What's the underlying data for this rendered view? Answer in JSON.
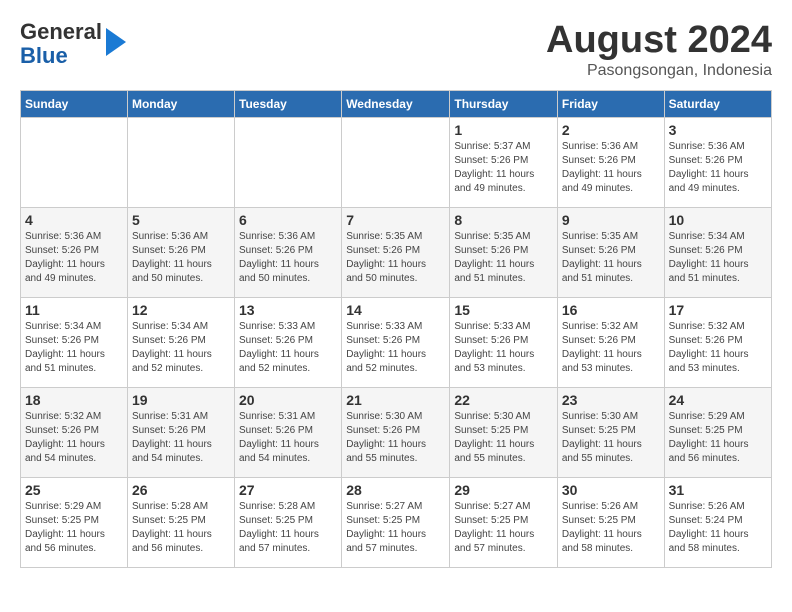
{
  "logo": {
    "line1": "General",
    "line2": "Blue"
  },
  "header": {
    "month": "August 2024",
    "location": "Pasongsongan, Indonesia"
  },
  "weekdays": [
    "Sunday",
    "Monday",
    "Tuesday",
    "Wednesday",
    "Thursday",
    "Friday",
    "Saturday"
  ],
  "weeks": [
    [
      {
        "day": "",
        "info": ""
      },
      {
        "day": "",
        "info": ""
      },
      {
        "day": "",
        "info": ""
      },
      {
        "day": "",
        "info": ""
      },
      {
        "day": "1",
        "info": "Sunrise: 5:37 AM\nSunset: 5:26 PM\nDaylight: 11 hours and 49 minutes."
      },
      {
        "day": "2",
        "info": "Sunrise: 5:36 AM\nSunset: 5:26 PM\nDaylight: 11 hours and 49 minutes."
      },
      {
        "day": "3",
        "info": "Sunrise: 5:36 AM\nSunset: 5:26 PM\nDaylight: 11 hours and 49 minutes."
      }
    ],
    [
      {
        "day": "4",
        "info": "Sunrise: 5:36 AM\nSunset: 5:26 PM\nDaylight: 11 hours and 49 minutes."
      },
      {
        "day": "5",
        "info": "Sunrise: 5:36 AM\nSunset: 5:26 PM\nDaylight: 11 hours and 50 minutes."
      },
      {
        "day": "6",
        "info": "Sunrise: 5:36 AM\nSunset: 5:26 PM\nDaylight: 11 hours and 50 minutes."
      },
      {
        "day": "7",
        "info": "Sunrise: 5:35 AM\nSunset: 5:26 PM\nDaylight: 11 hours and 50 minutes."
      },
      {
        "day": "8",
        "info": "Sunrise: 5:35 AM\nSunset: 5:26 PM\nDaylight: 11 hours and 51 minutes."
      },
      {
        "day": "9",
        "info": "Sunrise: 5:35 AM\nSunset: 5:26 PM\nDaylight: 11 hours and 51 minutes."
      },
      {
        "day": "10",
        "info": "Sunrise: 5:34 AM\nSunset: 5:26 PM\nDaylight: 11 hours and 51 minutes."
      }
    ],
    [
      {
        "day": "11",
        "info": "Sunrise: 5:34 AM\nSunset: 5:26 PM\nDaylight: 11 hours and 51 minutes."
      },
      {
        "day": "12",
        "info": "Sunrise: 5:34 AM\nSunset: 5:26 PM\nDaylight: 11 hours and 52 minutes."
      },
      {
        "day": "13",
        "info": "Sunrise: 5:33 AM\nSunset: 5:26 PM\nDaylight: 11 hours and 52 minutes."
      },
      {
        "day": "14",
        "info": "Sunrise: 5:33 AM\nSunset: 5:26 PM\nDaylight: 11 hours and 52 minutes."
      },
      {
        "day": "15",
        "info": "Sunrise: 5:33 AM\nSunset: 5:26 PM\nDaylight: 11 hours and 53 minutes."
      },
      {
        "day": "16",
        "info": "Sunrise: 5:32 AM\nSunset: 5:26 PM\nDaylight: 11 hours and 53 minutes."
      },
      {
        "day": "17",
        "info": "Sunrise: 5:32 AM\nSunset: 5:26 PM\nDaylight: 11 hours and 53 minutes."
      }
    ],
    [
      {
        "day": "18",
        "info": "Sunrise: 5:32 AM\nSunset: 5:26 PM\nDaylight: 11 hours and 54 minutes."
      },
      {
        "day": "19",
        "info": "Sunrise: 5:31 AM\nSunset: 5:26 PM\nDaylight: 11 hours and 54 minutes."
      },
      {
        "day": "20",
        "info": "Sunrise: 5:31 AM\nSunset: 5:26 PM\nDaylight: 11 hours and 54 minutes."
      },
      {
        "day": "21",
        "info": "Sunrise: 5:30 AM\nSunset: 5:26 PM\nDaylight: 11 hours and 55 minutes."
      },
      {
        "day": "22",
        "info": "Sunrise: 5:30 AM\nSunset: 5:25 PM\nDaylight: 11 hours and 55 minutes."
      },
      {
        "day": "23",
        "info": "Sunrise: 5:30 AM\nSunset: 5:25 PM\nDaylight: 11 hours and 55 minutes."
      },
      {
        "day": "24",
        "info": "Sunrise: 5:29 AM\nSunset: 5:25 PM\nDaylight: 11 hours and 56 minutes."
      }
    ],
    [
      {
        "day": "25",
        "info": "Sunrise: 5:29 AM\nSunset: 5:25 PM\nDaylight: 11 hours and 56 minutes."
      },
      {
        "day": "26",
        "info": "Sunrise: 5:28 AM\nSunset: 5:25 PM\nDaylight: 11 hours and 56 minutes."
      },
      {
        "day": "27",
        "info": "Sunrise: 5:28 AM\nSunset: 5:25 PM\nDaylight: 11 hours and 57 minutes."
      },
      {
        "day": "28",
        "info": "Sunrise: 5:27 AM\nSunset: 5:25 PM\nDaylight: 11 hours and 57 minutes."
      },
      {
        "day": "29",
        "info": "Sunrise: 5:27 AM\nSunset: 5:25 PM\nDaylight: 11 hours and 57 minutes."
      },
      {
        "day": "30",
        "info": "Sunrise: 5:26 AM\nSunset: 5:25 PM\nDaylight: 11 hours and 58 minutes."
      },
      {
        "day": "31",
        "info": "Sunrise: 5:26 AM\nSunset: 5:24 PM\nDaylight: 11 hours and 58 minutes."
      }
    ]
  ]
}
